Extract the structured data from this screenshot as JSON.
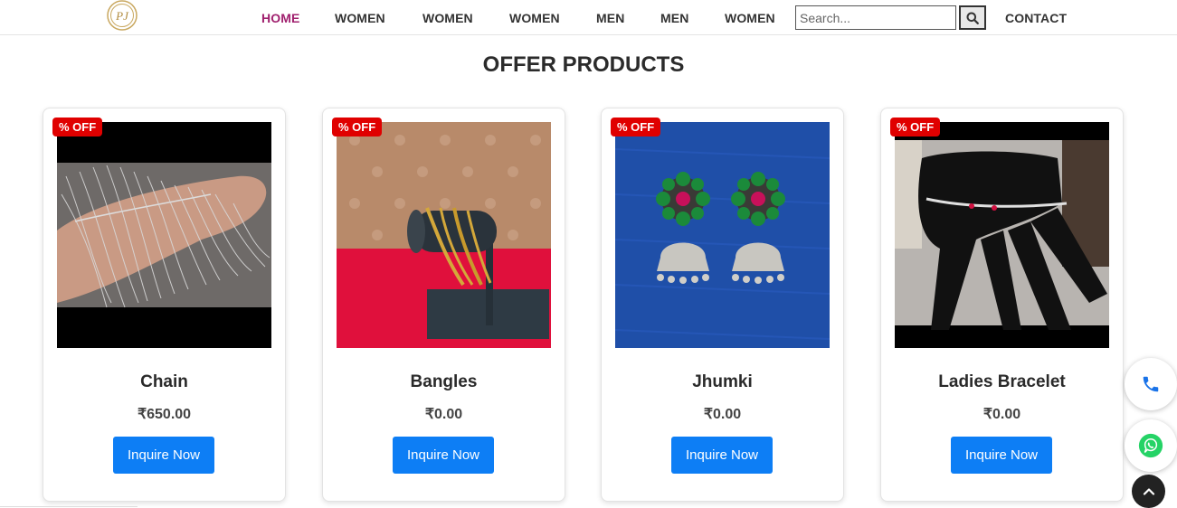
{
  "header": {
    "logo_text": "PJ",
    "nav": [
      {
        "label": "HOME",
        "active": true
      },
      {
        "label": "WOMEN",
        "active": false
      },
      {
        "label": "WOMEN",
        "active": false
      },
      {
        "label": "WOMEN",
        "active": false
      },
      {
        "label": "MEN",
        "active": false
      },
      {
        "label": "MEN",
        "active": false
      },
      {
        "label": "WOMEN",
        "active": false
      }
    ],
    "search_placeholder": "Search...",
    "search_icon": "search-icon",
    "contact_label": "CONTACT",
    "active_color": "#a0206e"
  },
  "section": {
    "title": "OFFER PRODUCTS"
  },
  "products": [
    {
      "badge": "% OFF",
      "name": "Chain",
      "price": "₹650.00",
      "button": "Inquire Now"
    },
    {
      "badge": "% OFF",
      "name": "Bangles",
      "price": "₹0.00",
      "button": "Inquire Now"
    },
    {
      "badge": "% OFF",
      "name": "Jhumki",
      "price": "₹0.00",
      "button": "Inquire Now"
    },
    {
      "badge": "% OFF",
      "name": "Ladies Bracelet",
      "price": "₹0.00",
      "button": "Inquire Now"
    }
  ],
  "floating": {
    "call_icon": "phone-icon",
    "whatsapp_icon": "whatsapp-icon",
    "top_icon": "chevron-up-icon"
  },
  "colors": {
    "badge": "#e00000",
    "button": "#0d7ef5",
    "whatsapp": "#25d366",
    "phone": "#1a73e8"
  }
}
